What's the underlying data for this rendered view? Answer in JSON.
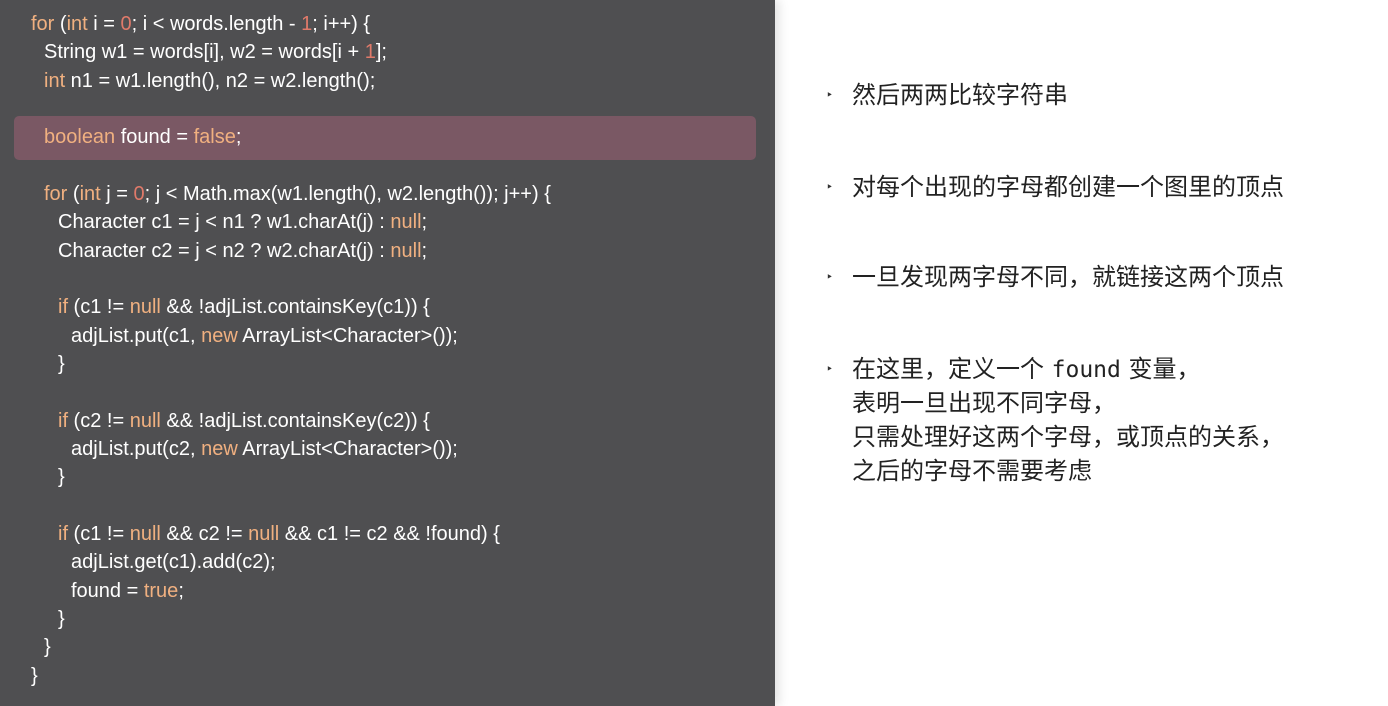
{
  "code": {
    "lines": [
      {
        "indent": 0,
        "parts": [
          {
            "t": "kw",
            "v": "for"
          },
          {
            "t": "p",
            "v": " ("
          },
          {
            "t": "kw",
            "v": "int"
          },
          {
            "t": "p",
            "v": " i = "
          },
          {
            "t": "num",
            "v": "0"
          },
          {
            "t": "p",
            "v": "; i < words.length - "
          },
          {
            "t": "num",
            "v": "1"
          },
          {
            "t": "p",
            "v": "; i++) {"
          }
        ]
      },
      {
        "indent": 1,
        "parts": [
          {
            "t": "p",
            "v": "String w1 = words[i], w2 = words[i + "
          },
          {
            "t": "num",
            "v": "1"
          },
          {
            "t": "p",
            "v": "];"
          }
        ]
      },
      {
        "indent": 1,
        "parts": [
          {
            "t": "kw",
            "v": "int"
          },
          {
            "t": "p",
            "v": " n1 = w1.length(), n2 = w2.length();"
          }
        ]
      },
      {
        "indent": 1,
        "highlight": true,
        "parts": [
          {
            "t": "kw",
            "v": "boolean"
          },
          {
            "t": "p",
            "v": " found = "
          },
          {
            "t": "kw",
            "v": "false"
          },
          {
            "t": "p",
            "v": ";"
          }
        ]
      },
      {
        "indent": 1,
        "parts": [
          {
            "t": "kw",
            "v": "for"
          },
          {
            "t": "p",
            "v": " ("
          },
          {
            "t": "kw",
            "v": "int"
          },
          {
            "t": "p",
            "v": " j = "
          },
          {
            "t": "num",
            "v": "0"
          },
          {
            "t": "p",
            "v": "; j < Math.max(w1.length(), w2.length()); j++) {"
          }
        ]
      },
      {
        "indent": 2,
        "parts": [
          {
            "t": "p",
            "v": "Character c1 = j < n1 ? w1.charAt(j) : "
          },
          {
            "t": "kw",
            "v": "null"
          },
          {
            "t": "p",
            "v": ";"
          }
        ]
      },
      {
        "indent": 2,
        "parts": [
          {
            "t": "p",
            "v": "Character c2 = j < n2 ? w2.charAt(j) : "
          },
          {
            "t": "kw",
            "v": "null"
          },
          {
            "t": "p",
            "v": ";"
          }
        ]
      },
      {
        "indent": 2,
        "parts": [
          {
            "t": "kw",
            "v": "if"
          },
          {
            "t": "p",
            "v": " (c1 != "
          },
          {
            "t": "kw",
            "v": "null"
          },
          {
            "t": "p",
            "v": " && !adjList.containsKey(c1)) {"
          }
        ]
      },
      {
        "indent": 3,
        "parts": [
          {
            "t": "p",
            "v": "adjList.put(c1, "
          },
          {
            "t": "kw",
            "v": "new"
          },
          {
            "t": "p",
            "v": " ArrayList<Character>());"
          }
        ]
      },
      {
        "indent": 2,
        "parts": [
          {
            "t": "p",
            "v": "}"
          }
        ]
      },
      {
        "indent": 2,
        "parts": [
          {
            "t": "kw",
            "v": "if"
          },
          {
            "t": "p",
            "v": " (c2 != "
          },
          {
            "t": "kw",
            "v": "null"
          },
          {
            "t": "p",
            "v": " && !adjList.containsKey(c2)) {"
          }
        ]
      },
      {
        "indent": 3,
        "parts": [
          {
            "t": "p",
            "v": "adjList.put(c2, "
          },
          {
            "t": "kw",
            "v": "new"
          },
          {
            "t": "p",
            "v": " ArrayList<Character>());"
          }
        ]
      },
      {
        "indent": 2,
        "parts": [
          {
            "t": "p",
            "v": "}"
          }
        ]
      },
      {
        "indent": 2,
        "parts": [
          {
            "t": "kw",
            "v": "if"
          },
          {
            "t": "p",
            "v": " (c1 != "
          },
          {
            "t": "kw",
            "v": "null"
          },
          {
            "t": "p",
            "v": " && c2 != "
          },
          {
            "t": "kw",
            "v": "null"
          },
          {
            "t": "p",
            "v": " && c1 != c2 && !found) {"
          }
        ]
      },
      {
        "indent": 3,
        "parts": [
          {
            "t": "p",
            "v": "adjList.get(c1).add(c2);"
          }
        ]
      },
      {
        "indent": 3,
        "parts": [
          {
            "t": "p",
            "v": "found = "
          },
          {
            "t": "kw",
            "v": "true"
          },
          {
            "t": "p",
            "v": ";"
          }
        ]
      },
      {
        "indent": 2,
        "parts": [
          {
            "t": "p",
            "v": "}"
          }
        ]
      },
      {
        "indent": 1,
        "parts": [
          {
            "t": "p",
            "v": "}"
          }
        ]
      },
      {
        "indent": 0,
        "parts": [
          {
            "t": "p",
            "v": "}"
          }
        ]
      }
    ]
  },
  "bullets": [
    {
      "marker": "‣",
      "lines": [
        "然后两两比较字符串"
      ]
    },
    {
      "marker": "‣",
      "lines": [
        "对每个出现的字母都创建一个图里的顶点"
      ]
    },
    {
      "marker": "‣",
      "lines": [
        "一旦发现两字母不同，就链接这两个顶点"
      ]
    },
    {
      "marker": "‣",
      "lines": [
        "在这里，定义一个 found 变量，",
        "表明一旦出现不同字母，",
        "只需处理好这两个字母，或顶点的关系，",
        "之后的字母不需要考虑"
      ],
      "code_word": "found"
    }
  ],
  "colors": {
    "code_background": "#4f4f51",
    "highlight": "#7a5864",
    "keyword": "#f0b080",
    "number": "#e07a6a",
    "code_text": "#ffffff",
    "slide_background": "#ffffff"
  }
}
